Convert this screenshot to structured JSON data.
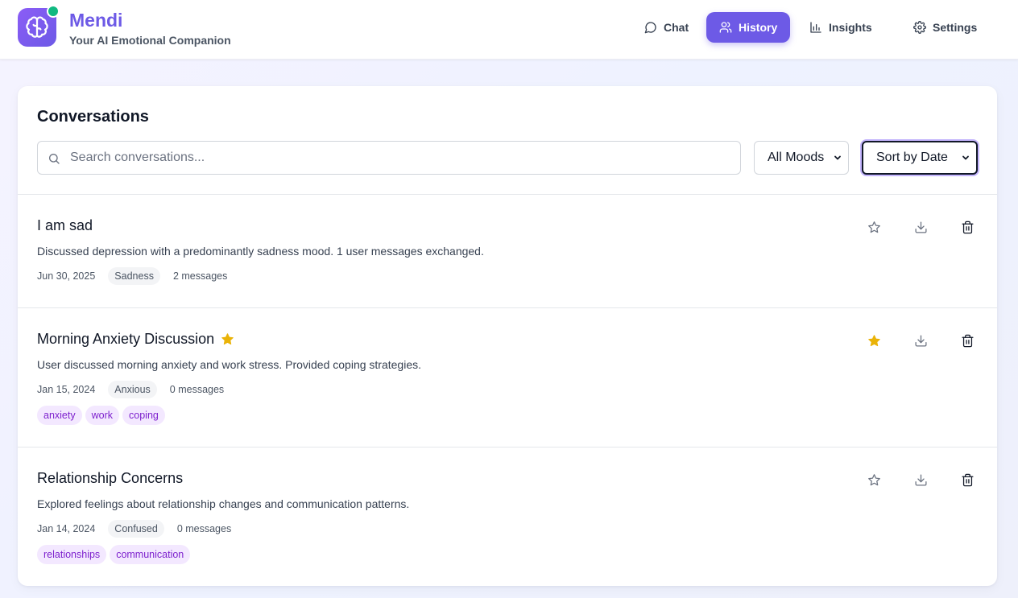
{
  "app": {
    "name": "Mendi",
    "tagline": "Your AI Emotional Companion",
    "logo_icon": "brain-icon",
    "status_color": "#10b981",
    "accent_color": "#6d5ae6"
  },
  "nav": [
    {
      "id": "chat",
      "label": "Chat",
      "icon": "chat-bubble-icon",
      "active": false
    },
    {
      "id": "history",
      "label": "History",
      "icon": "users-icon",
      "active": true
    },
    {
      "id": "insights",
      "label": "Insights",
      "icon": "bar-chart-icon",
      "active": false
    },
    {
      "id": "settings",
      "label": "Settings",
      "icon": "gear-icon",
      "active": false
    }
  ],
  "conversations_panel": {
    "title": "Conversations",
    "search": {
      "placeholder": "Search conversations...",
      "value": ""
    },
    "mood_filter": {
      "selected": "All Moods"
    },
    "sort": {
      "selected": "Sort by Date"
    }
  },
  "conversations": [
    {
      "title": "I am sad",
      "favorite": false,
      "description": "Discussed depression with a predominantly sadness mood. 1 user messages exchanged.",
      "date": "Jun 30, 2025",
      "mood": "Sadness",
      "messages": "2 messages",
      "tags": []
    },
    {
      "title": "Morning Anxiety Discussion",
      "favorite": true,
      "description": "User discussed morning anxiety and work stress. Provided coping strategies.",
      "date": "Jan 15, 2024",
      "mood": "Anxious",
      "messages": "0 messages",
      "tags": [
        "anxiety",
        "work",
        "coping"
      ]
    },
    {
      "title": "Relationship Concerns",
      "favorite": false,
      "description": "Explored feelings about relationship changes and communication patterns.",
      "date": "Jan 14, 2024",
      "mood": "Confused",
      "messages": "0 messages",
      "tags": [
        "relationships",
        "communication"
      ]
    }
  ],
  "colors": {
    "favorite_star": "#eab308",
    "tag_text": "#7e22ce",
    "tag_bg": "#f3e8ff"
  }
}
